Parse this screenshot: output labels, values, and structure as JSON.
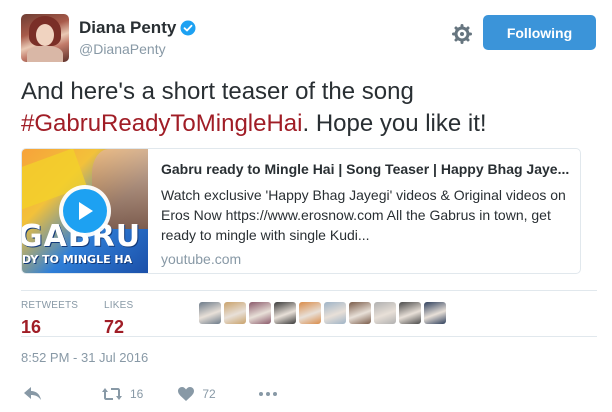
{
  "user": {
    "display_name": "Diana Penty",
    "handle": "@DianaPenty",
    "avatar_icon": "avatar",
    "verified_icon": "verified-badge-icon"
  },
  "follow_button": {
    "label": "Following",
    "color": "#3b94d9"
  },
  "tweet": {
    "text_before": "And here's a short teaser of the song ",
    "hashtag": "#GabruReadyToMingleHai",
    "text_after": ". Hope you like it!",
    "hashtag_color": "#a01d26"
  },
  "card": {
    "title": "Gabru ready to Mingle Hai | Song Teaser | Happy Bhag Jaye...",
    "description": "Watch exclusive 'Happy Bhag Jayegi' videos & Original videos on Eros Now https://www.erosnow.com All the Gabrus in town, get ready to mingle with single Kudi...",
    "domain": "youtube.com",
    "thumbnail_text_big": "GABRU",
    "thumbnail_text_small": "DY TO MINGLE HA"
  },
  "stats": {
    "retweets_label": "RETWEETS",
    "retweets_value": "16",
    "likes_label": "LIKES",
    "likes_value": "72"
  },
  "likers": [
    "#6c7a89",
    "#c9a26b",
    "#8b5a6b",
    "#3a3a3a",
    "#d98c4a",
    "#9fb4c7",
    "#7a5c4a",
    "#b0b0b0",
    "#4a4a4a",
    "#2e3f5c"
  ],
  "timestamp": "8:52 PM - 31 Jul 2016",
  "actions": {
    "reply_icon": "reply-icon",
    "retweet_icon": "retweet-icon",
    "retweet_count": "16",
    "like_icon": "heart-icon",
    "like_count": "72",
    "more_icon": "more-dots-icon"
  },
  "colors": {
    "accent_red": "#a01d26",
    "link_blue": "#1da1f2",
    "muted": "#8899a6"
  }
}
